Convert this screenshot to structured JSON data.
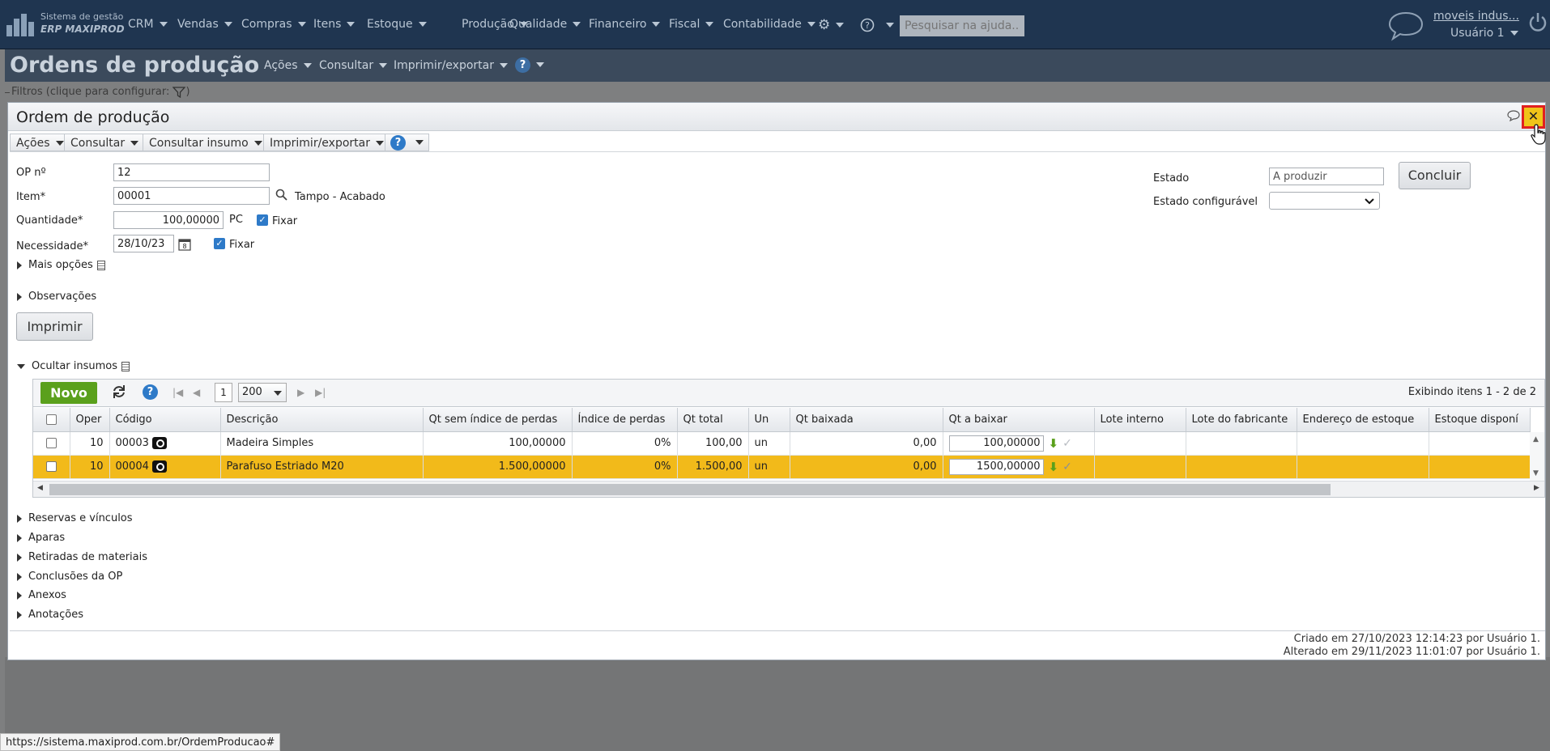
{
  "topbar": {
    "logo_line1": "Sistema de gestão",
    "logo_line2": "ERP MAXIPROD",
    "nav": [
      "CRM",
      "Vendas",
      "Compras",
      "Itens",
      "Estoque",
      "Produção",
      "Qualidade",
      "Financeiro",
      "Fiscal",
      "Contabilidade"
    ],
    "help_search_placeholder": "Pesquisar na ajuda...",
    "user_company": "moveis indus...",
    "user_name": "Usuário 1"
  },
  "page": {
    "title": "Ordens de produção",
    "menu": [
      "Ações",
      "Consultar",
      "Imprimir/exportar"
    ],
    "filters_label": "Filtros (clique para configurar:",
    "filters_suffix": ")"
  },
  "modal": {
    "title": "Ordem de produção",
    "close_label": "✕",
    "toolbar": [
      "Ações",
      "Consultar",
      "Consultar insumo",
      "Imprimir/exportar"
    ],
    "help_label": "?",
    "form": {
      "op_label": "OP nº",
      "op_value": "12",
      "item_label": "Item*",
      "item_value": "00001",
      "item_desc": "Tampo - Acabado",
      "qty_label": "Quantidade*",
      "qty_value": "100,00000",
      "qty_unit": "PC",
      "fix_label": "Fixar",
      "need_label": "Necessidade*",
      "need_value": "28/10/23",
      "state_label": "Estado",
      "state_value": "A produzir",
      "config_state_label": "Estado configurável",
      "config_state_value": "",
      "conclude_label": "Concluir",
      "more_options": "Mais opções",
      "notes": "Observações",
      "print_label": "Imprimir"
    },
    "inputs_section": "Ocultar insumos",
    "grid": {
      "new_label": "Novo",
      "page": "1",
      "page_size": "200",
      "count_text": "Exibindo itens 1 - 2 de 2",
      "columns": [
        "Oper",
        "Código",
        "Descrição",
        "Qt sem índice de perdas",
        "Índice de perdas",
        "Qt total",
        "Un",
        "Qt baixada",
        "Qt a baixar",
        "Lote interno",
        "Lote do fabricante",
        "Endereço de estoque",
        "Estoque disponí"
      ],
      "rows": [
        {
          "oper": "10",
          "code": "00003",
          "desc": "Madeira Simples",
          "qt_sem": "100,00000",
          "indice": "0%",
          "qt_total": "100,00",
          "un": "un",
          "qt_baixada": "0,00",
          "qt_a_baixar": "100,00000"
        },
        {
          "oper": "10",
          "code": "00004",
          "desc": "Parafuso Estriado M20",
          "qt_sem": "1.500,00000",
          "indice": "0%",
          "qt_total": "1.500,00",
          "un": "un",
          "qt_baixada": "0,00",
          "qt_a_baixar": "1500,00000"
        }
      ]
    },
    "sections": [
      "Reservas e vínculos",
      "Aparas",
      "Retiradas de materiais",
      "Conclusões da OP",
      "Anexos",
      "Anotações"
    ],
    "created": "Criado em 27/10/2023 12:14:23 por Usuário 1.",
    "modified": "Alterado em 29/11/2023 11:01:07 por Usuário 1."
  },
  "status_url": "https://sistema.maxiprod.com.br/OrdemProducao#"
}
